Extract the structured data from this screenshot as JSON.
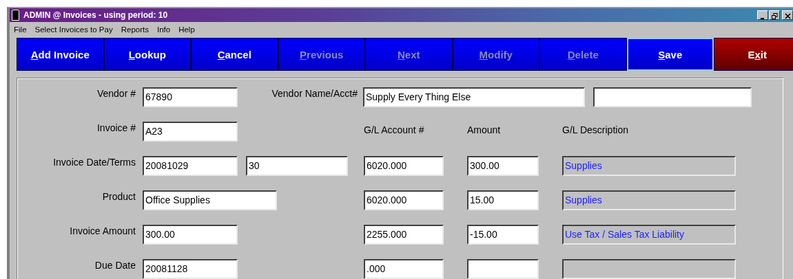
{
  "window": {
    "title": "ADMIN @ Invoices - using period: 10"
  },
  "menu": [
    "File",
    "Select Invoices to Pay",
    "Reports",
    "Info",
    "Help"
  ],
  "toolbar": [
    {
      "label": "Add Invoice",
      "first_underlined": true,
      "second_underlined": false,
      "kind": "normal",
      "disabled": false,
      "focused": false
    },
    {
      "label": "Lookup",
      "first_underlined": true,
      "second_underlined": false,
      "kind": "normal",
      "disabled": false,
      "focused": false
    },
    {
      "label": "Cancel",
      "first_underlined": true,
      "second_underlined": false,
      "kind": "normal",
      "disabled": false,
      "focused": false
    },
    {
      "label": "Previous",
      "first_underlined": true,
      "second_underlined": false,
      "kind": "normal",
      "disabled": true,
      "focused": false
    },
    {
      "label": "Next",
      "first_underlined": true,
      "second_underlined": false,
      "kind": "normal",
      "disabled": true,
      "focused": false
    },
    {
      "label": "Modify",
      "first_underlined": true,
      "second_underlined": false,
      "kind": "normal",
      "disabled": true,
      "focused": false
    },
    {
      "label": "Delete",
      "first_underlined": true,
      "second_underlined": false,
      "kind": "normal",
      "disabled": true,
      "focused": false
    },
    {
      "label": "Save",
      "first_underlined": true,
      "second_underlined": false,
      "kind": "normal",
      "disabled": false,
      "focused": true
    },
    {
      "label": "Exit",
      "first_underlined": false,
      "second_underlined": true,
      "kind": "exit",
      "disabled": false,
      "focused": false
    }
  ],
  "vendor": {
    "label": "Vendor #",
    "value": "67890",
    "name_label": "Vendor Name/Acct#",
    "name": "Supply Every Thing Else"
  },
  "fields": [
    {
      "label": "Invoice #",
      "kind": "short",
      "values": [
        "A23"
      ]
    },
    {
      "label": "Invoice Date/Terms",
      "kind": "short",
      "values": [
        "20081029",
        "30"
      ]
    },
    {
      "label": "Product",
      "kind": "wide",
      "values": [
        "Office Supplies"
      ]
    },
    {
      "label": "Invoice Amount",
      "kind": "short",
      "values": [
        "300.00"
      ]
    },
    {
      "label": "Due Date",
      "kind": "short",
      "values": [
        "20081128"
      ]
    }
  ],
  "gl": {
    "headers": [
      "G/L Account #",
      "Amount",
      "G/L Description"
    ],
    "lines": [
      {
        "account": "6020.000",
        "amount": "300.00",
        "description": "Supplies"
      },
      {
        "account": "6020.000",
        "amount": "15.00",
        "description": "Supplies"
      },
      {
        "account": "2255.000",
        "amount": "-15.00",
        "description": "Use Tax / Sales Tax Liability"
      },
      {
        "account": ".000"
      }
    ]
  }
}
